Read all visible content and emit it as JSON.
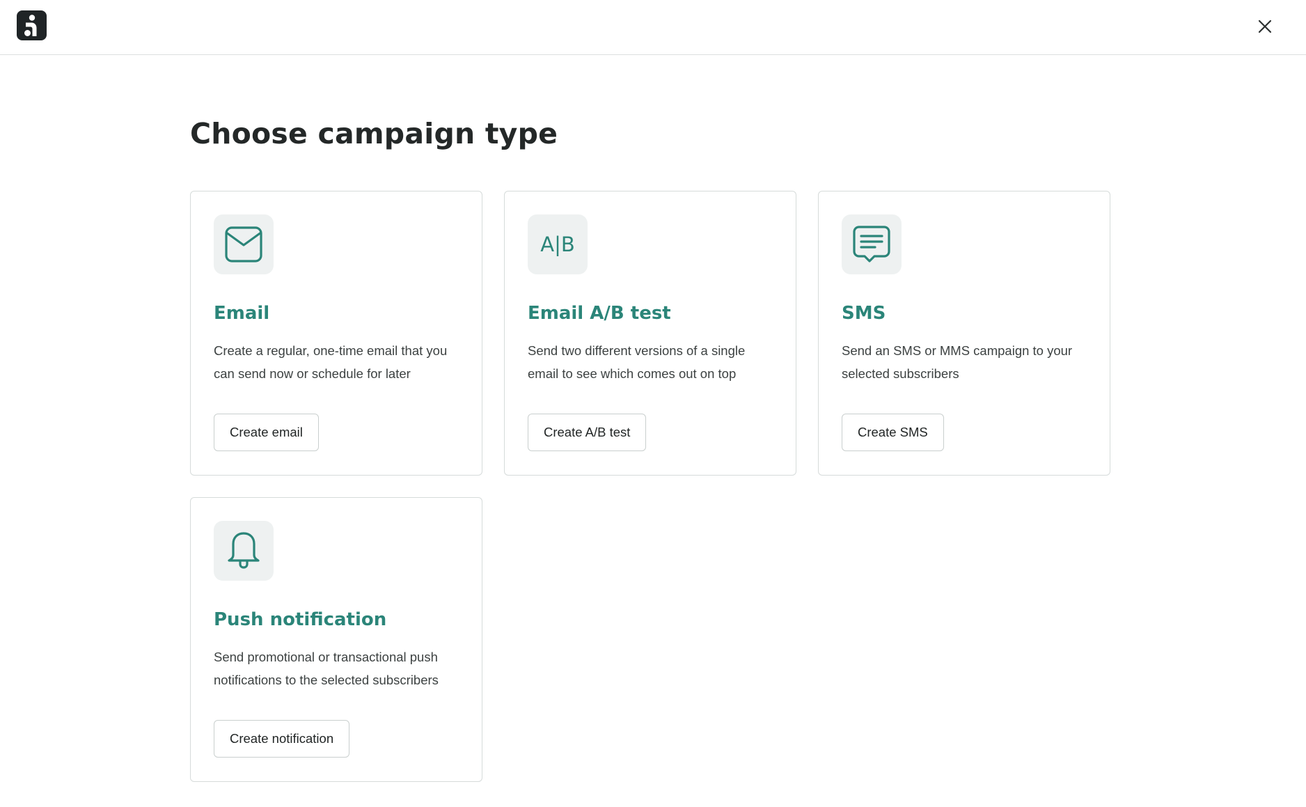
{
  "header": {
    "logo_icon": "brand-logo",
    "close_icon": "close-icon"
  },
  "page": {
    "title": "Choose campaign type"
  },
  "colors": {
    "accent": "#2b8579",
    "icon_tile_bg": "#eef1f1",
    "card_border": "#d6dbda",
    "logo_bg": "#1f2426"
  },
  "cards": [
    {
      "icon": "envelope-icon",
      "title": "Email",
      "description": "Create a regular, one-time email that you can send now or schedule for later",
      "button": "Create email"
    },
    {
      "icon": "ab-test-icon",
      "icon_text": "A|B",
      "title": "Email A/B test",
      "description": "Send two different versions of a single email to see which comes out on top",
      "button": "Create A/B test"
    },
    {
      "icon": "chat-bubble-icon",
      "title": "SMS",
      "description": "Send an SMS or MMS campaign to your selected subscribers",
      "button": "Create SMS"
    },
    {
      "icon": "bell-icon",
      "title": "Push notification",
      "description": "Send promotional or transactional push notifications to the selected subscribers",
      "button": "Create notification"
    }
  ]
}
